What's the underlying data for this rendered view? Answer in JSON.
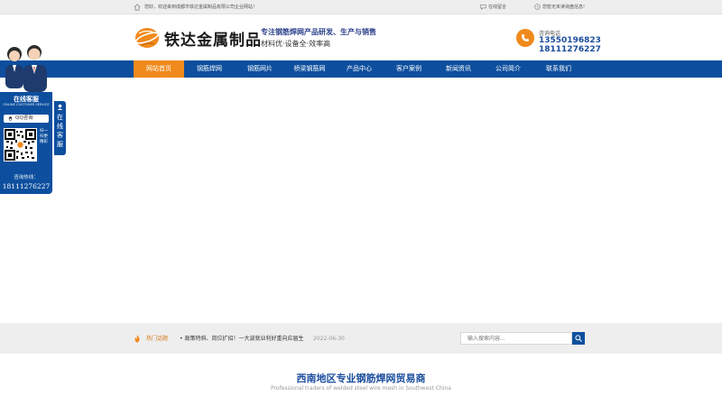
{
  "topbar": {
    "welcome": "您好，欢迎来到成都市铁达金属制品有限公司企业网站！",
    "message_link": "在线留言",
    "favorite_link": "您暂无未读询盘信息!"
  },
  "header": {
    "logo_text": "铁达金属制品",
    "slogan_main": "专注钢筋焊网产品研发、生产与销售",
    "slogan_sub": "材料优·设备全·效率高",
    "consult_label": "咨询电话",
    "phone1": "13550196823",
    "phone2": "18111276227"
  },
  "nav": {
    "items": [
      {
        "label": "网站首页"
      },
      {
        "label": "钢筋焊网"
      },
      {
        "label": "钢筋网片"
      },
      {
        "label": "桥梁钢筋网"
      },
      {
        "label": "产品中心"
      },
      {
        "label": "客户案例"
      },
      {
        "label": "新闻资讯"
      },
      {
        "label": "公司简介"
      },
      {
        "label": "联系我们"
      }
    ],
    "active_index": 0
  },
  "hotbar": {
    "label": "热门话题",
    "news": "• 政策特斜、岗位扩招！一大波就业利好重向应届生",
    "date": "2022-06-30",
    "search_placeholder": "输入搜索内容..."
  },
  "section": {
    "title": "西南地区专业钢筋焊网贸易商",
    "subtitle": "Professional traders of welded steel wire mesh in Southwest China"
  },
  "service": {
    "title": "在线客服",
    "subtitle": "ONLINE CUSTOMER SERVICE",
    "qq_label": "QQ咨询",
    "qr_caption": "扫一扫更精彩",
    "tel_label": "咨询热线：",
    "tel": "18111276227",
    "tab_text": "在线客服"
  },
  "colors": {
    "brand_blue": "#0d4f9e",
    "accent_orange": "#f08a1c",
    "title_blue": "#1a4d9c"
  },
  "icons": [
    "home-icon",
    "message-icon",
    "star-icon",
    "phone-icon",
    "fire-icon",
    "search-icon",
    "qq-icon",
    "headset-icon"
  ]
}
